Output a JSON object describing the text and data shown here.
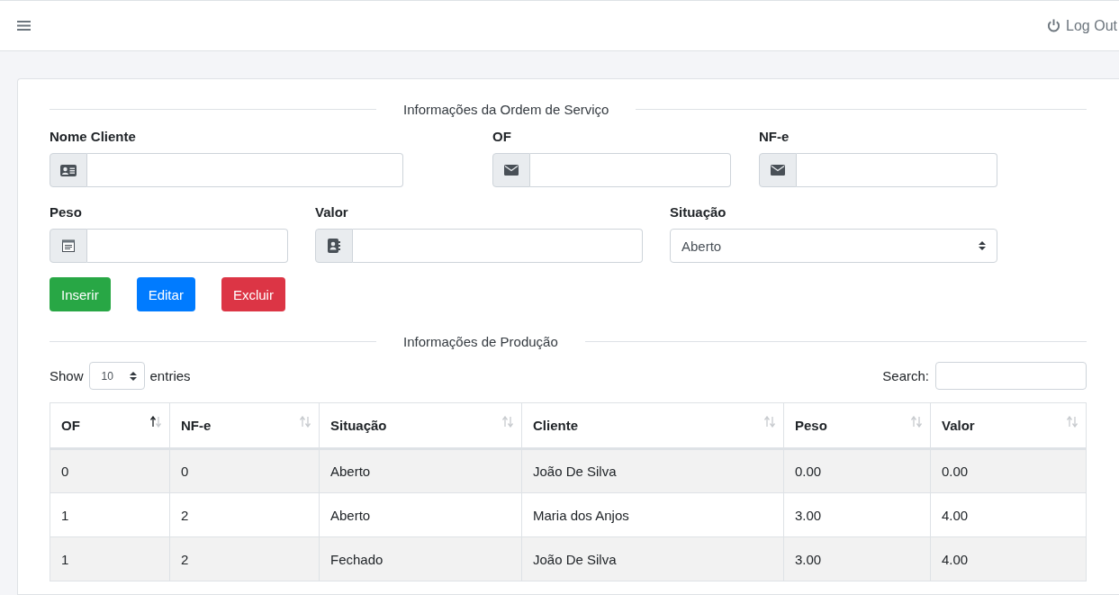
{
  "navbar": {
    "logout": "Log Out"
  },
  "order_form": {
    "title": "Informações da Ordem de Serviço",
    "fields": [
      {
        "label": "Nome Cliente",
        "kind": "input"
      },
      {
        "label": "OF",
        "kind": "input"
      },
      {
        "label": "NF-e",
        "kind": "input"
      },
      {
        "label": "Peso",
        "kind": "input"
      },
      {
        "label": "Valor",
        "kind": "input"
      },
      {
        "label": "Situação",
        "kind": "select",
        "value": "Aberto"
      }
    ],
    "buttons": [
      {
        "label": "Inserir",
        "kind": "success"
      },
      {
        "label": "Editar",
        "kind": "primary"
      },
      {
        "label": "Excluir",
        "kind": "danger"
      }
    ]
  },
  "production": {
    "title": "Informações de Produção",
    "show_label": "Show",
    "page_length": "10",
    "entries_label": "entries",
    "search_label": "Search:",
    "columns": [
      {
        "label": "OF",
        "sorted": true
      },
      {
        "label": "NF-e",
        "sorted": false
      },
      {
        "label": "Situação",
        "sorted": false
      },
      {
        "label": "Cliente",
        "sorted": false
      },
      {
        "label": "Peso",
        "sorted": false
      },
      {
        "label": "Valor",
        "sorted": false
      }
    ],
    "rows": [
      [
        "0",
        "0",
        "Aberto",
        "João De Silva",
        "0.00",
        "0.00"
      ],
      [
        "1",
        "2",
        "Aberto",
        "Maria dos Anjos",
        "3.00",
        "4.00"
      ],
      [
        "1",
        "2",
        "Fechado",
        "João De Silva",
        "3.00",
        "4.00"
      ]
    ]
  }
}
